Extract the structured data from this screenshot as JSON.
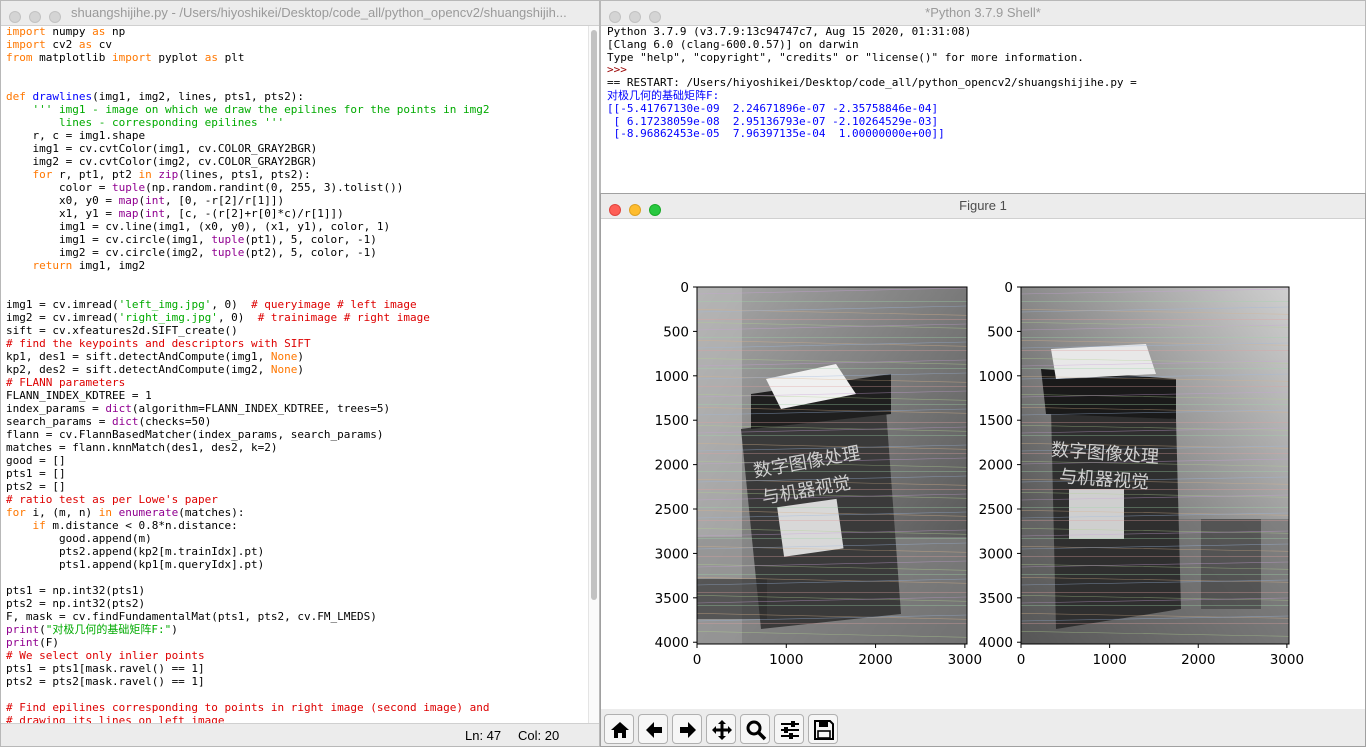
{
  "editor": {
    "title": "shuangshijihe.py - /Users/hiyoshikei/Desktop/code_all/python_opencv2/shuangshijih...",
    "status_line": "Ln: 47",
    "status_col": "Col: 20"
  },
  "shell": {
    "title": "*Python 3.7.9 Shell*",
    "lines": [
      "Python 3.7.9 (v3.7.9:13c94747c7, Aug 15 2020, 01:31:08)",
      "[Clang 6.0 (clang-600.0.57)] on darwin",
      "Type \"help\", \"copyright\", \"credits\" or \"license()\" for more information.",
      ">>>",
      "== RESTART: /Users/hiyoshikei/Desktop/code_all/python_opencv2/shuangshijihe.py =",
      "对极几何的基础矩阵F:",
      "[[-5.41767130e-09  2.24671896e-07 -2.35758846e-04]",
      " [ 6.17238059e-08  2.95136793e-07 -2.10264529e-03]",
      " [-8.96862453e-05  7.96397135e-04  1.00000000e+00]]"
    ]
  },
  "figure": {
    "title": "Figure 1",
    "left_axes": {
      "yticks": [
        "0",
        "500",
        "1000",
        "1500",
        "2000",
        "2500",
        "3000",
        "3500",
        "4000"
      ],
      "xticks": [
        "0",
        "1000",
        "2000",
        "3000"
      ]
    },
    "right_axes": {
      "yticks": [
        "0",
        "500",
        "1000",
        "1500",
        "2000",
        "2500",
        "3000",
        "3500",
        "4000"
      ],
      "xticks": [
        "0",
        "1000",
        "2000",
        "3000"
      ]
    },
    "left_image_text": [
      "数字图像处理",
      "与机器视觉"
    ],
    "right_image_text": [
      "数字图像处理",
      "与机器视觉"
    ],
    "toolbar": [
      "home-icon",
      "back-arrow-icon",
      "forward-arrow-icon",
      "pan-move-icon",
      "zoom-magnifier-icon",
      "configure-subplots-icon",
      "save-icon"
    ]
  },
  "colors": {
    "keyword": "#ff7700",
    "builtin": "#900090",
    "string": "#00aa00",
    "comment": "#dd0000",
    "def_name": "#0000ff"
  }
}
